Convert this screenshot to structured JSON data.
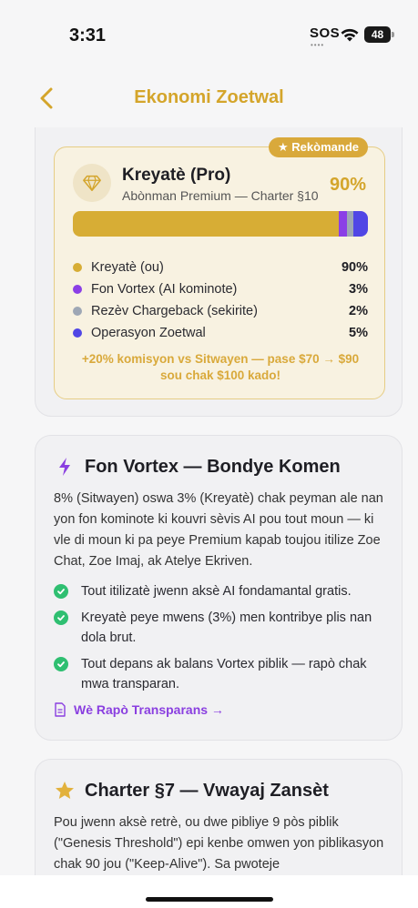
{
  "status": {
    "time": "3:31",
    "sos": "SOS",
    "battery": "48"
  },
  "nav": {
    "title": "Ekonomi Zoetwal"
  },
  "plan": {
    "badge": "★ Rekòmande",
    "name": "Kreyatè (Pro)",
    "subtitle": "Abònman Premium — Charter §10",
    "percent": "90%",
    "split": [
      {
        "label": "Kreyatè (ou)",
        "value": "90%",
        "share": 90,
        "color": "#d7ad35"
      },
      {
        "label": "Fon Vortex (AI kominote)",
        "value": "3%",
        "share": 3,
        "color": "#8b3fe6"
      },
      {
        "label": "Rezèv Chargeback (sekirite)",
        "value": "2%",
        "share": 2,
        "color": "#9ea7b5"
      },
      {
        "label": "Operasyon Zoetwal",
        "value": "5%",
        "share": 5,
        "color": "#5046e5"
      }
    ],
    "promo": "+20% komisyon vs Sitwayen — pase $70 → $90 sou chak $100 kado!"
  },
  "vortex": {
    "title": "Fon Vortex — Bondye Komen",
    "body": "8% (Sitwayen) oswa 3% (Kreyatè) chak peyman ale nan yon fon kominote ki kouvri sèvis AI pou tout moun — ki vle di moun ki pa peye Premium kapab toujou itilize Zoe Chat, Zoe Imaj, ak Atelye Ekriven.",
    "points": [
      "Tout itilizatè jwenn aksè AI fondamantal gratis.",
      "Kreyatè peye mwens (3%) men kontribye plis nan dola brut.",
      "Tout depans ak balans Vortex piblik — rapò chak mwa transparan."
    ],
    "link": "Wè Rapò Transparans →"
  },
  "charter": {
    "title": "Charter §7 — Vwayaj Zansèt",
    "body": "Pou jwenn aksè retrè, ou dwe pibliye 9 pòs piblik (\"Genesis Threshold\") epi kenbe omwen yon piblikasyon chak 90 jou (\"Keep-Alive\"). Sa pwoteje"
  },
  "colors": {
    "accent": "#d4a52b",
    "purple": "#8a3fe0",
    "check": "#2fbf71"
  }
}
